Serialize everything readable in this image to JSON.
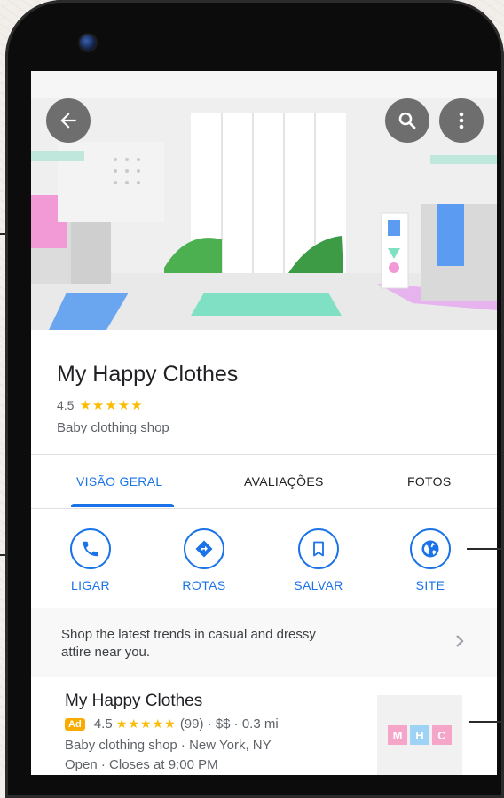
{
  "place": {
    "name": "My Happy Clothes",
    "rating": "4.5",
    "stars": "★★★★★",
    "category": "Baby clothing shop"
  },
  "tabs": [
    {
      "label": "VISÃO GERAL",
      "active": true
    },
    {
      "label": "AVALIAÇÕES",
      "active": false
    },
    {
      "label": "FOTOS",
      "active": false
    }
  ],
  "actions": [
    {
      "label": "LIGAR",
      "icon": "phone-icon"
    },
    {
      "label": "ROTAS",
      "icon": "directions-icon"
    },
    {
      "label": "SALVAR",
      "icon": "bookmark-icon"
    },
    {
      "label": "SITE",
      "icon": "globe-icon"
    }
  ],
  "promo": {
    "text": "Shop the latest trends in casual and dressy attire near you.",
    "icon": "chevron-right-icon"
  },
  "ad_listing": {
    "name": "My Happy Clothes",
    "badge": "Ad",
    "rating": "4.5",
    "stars": "★★★★★",
    "meta": "(99) · $$ · 0.3 mi",
    "category_location": "Baby clothing shop  ·  New York, NY",
    "hours": "Open · Closes at 9:00 PM",
    "logo_letters": [
      "M",
      "H",
      "C"
    ]
  },
  "colors": {
    "accent": "#1a73e8",
    "star": "#fbbc04",
    "logo": [
      "#f5a5c8",
      "#9fd3f5",
      "#f5a5c8"
    ]
  }
}
